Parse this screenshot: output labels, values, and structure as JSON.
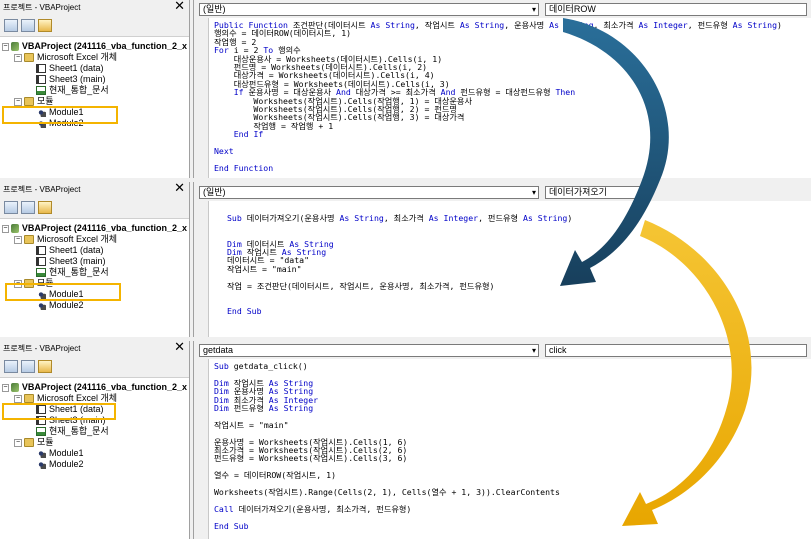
{
  "panel1": {
    "explorer_title": "프로젝트 - VBAProject",
    "tree": [
      "VBAProject (241116_vba_function_2_x",
      "Microsoft Excel 개체",
      "Sheet1 (data)",
      "Sheet3 (main)",
      "현재_통합_문서",
      "모듈",
      "Module1",
      "Module2"
    ],
    "dropdown_left": "(일반)",
    "dropdown_right": "데이터ROW",
    "code": [
      "Public Function 조건판단(데이터시트 As String, 작업시트 As String, 운용사명 As String, 최소가격 As Integer, 펀드유형 As String)",
      "행의수 = 데이터ROW(데이터시트, 1)",
      "작업행 = 2",
      "For i = 2 To 행의수",
      "    대상운용사 = Worksheets(데이터시트).Cells(i, 1)",
      "    펀드명 = Worksheets(데이터시트).Cells(i, 2)",
      "    대상가격 = Worksheets(데이터시트).Cells(i, 4)",
      "    대상펀드유형 = Worksheets(데이터시트).Cells(i, 3)",
      "    If 운용사명 = 대상운용사 And 대상가격 >= 최소가격 And 펀드유형 = 대상펀드유형 Then",
      "        Worksheets(작업시트).Cells(작업행, 1) = 대상운용사",
      "        Worksheets(작업시트).Cells(작업행, 2) = 펀드명",
      "        Worksheets(작업시트).Cells(작업행, 3) = 대상가격",
      "        작업행 = 작업행 + 1",
      "    End If",
      "",
      "Next",
      "",
      "End Function"
    ]
  },
  "panel2": {
    "explorer_title": "프로젝트 - VBAProject",
    "tree": [
      "VBAProject (241116_vba_function_2_x",
      "Microsoft Excel 개체",
      "Sheet1 (data)",
      "Sheet3 (main)",
      "현재_통합_문서",
      "모듈",
      "Module1",
      "Module2"
    ],
    "dropdown_left": "(일반)",
    "dropdown_right": "데이터가져오기",
    "code": [
      "",
      "Sub 데이터가져오기(운용사명 As String, 최소가격 As Integer, 펀드유형 As String)",
      "",
      "",
      "Dim 데이터시트 As String",
      "Dim 작업시트 As String",
      "데이터시트 = \"data\"",
      "작업시트 = \"main\"",
      "",
      "작업 = 조건판단(데이터시트, 작업시트, 운용사명, 최소가격, 펀드유형)",
      "",
      "",
      "End Sub"
    ]
  },
  "panel3": {
    "explorer_title": "프로젝트 - VBAProject",
    "tree": [
      "VBAProject (241116_vba_function_2_x",
      "Microsoft Excel 개체",
      "Sheet1 (data)",
      "Sheet3 (main)",
      "현재_통합_문서",
      "모듈",
      "Module1",
      "Module2"
    ],
    "dropdown_left": "getdata",
    "dropdown_right": "click",
    "code": [
      "Sub getdata_click()",
      "",
      "Dim 작업시트 As String",
      "Dim 운용사명 As String",
      "Dim 최소가격 As Integer",
      "Dim 펀드유형 As String",
      "",
      "작업시트 = \"main\"",
      "",
      "운용사명 = Worksheets(작업시트).Cells(1, 6)",
      "최소가격 = Worksheets(작업시트).Cells(2, 6)",
      "펀드유형 = Worksheets(작업시트).Cells(3, 6)",
      "",
      "열수 = 데이터ROW(작업시트, 1)",
      "",
      "Worksheets(작업시트).Range(Cells(2, 1), Cells(열수 + 1, 3)).ClearContents",
      "",
      "Call 데이터가져오기(운용사명, 최소가격, 펀드유형)",
      "",
      "End Sub"
    ]
  },
  "colors": {
    "highlight": "#f4b400",
    "arrow_dark": "#1f5f86",
    "arrow_gold": "#f4b400",
    "keyword": "#0000c8"
  }
}
